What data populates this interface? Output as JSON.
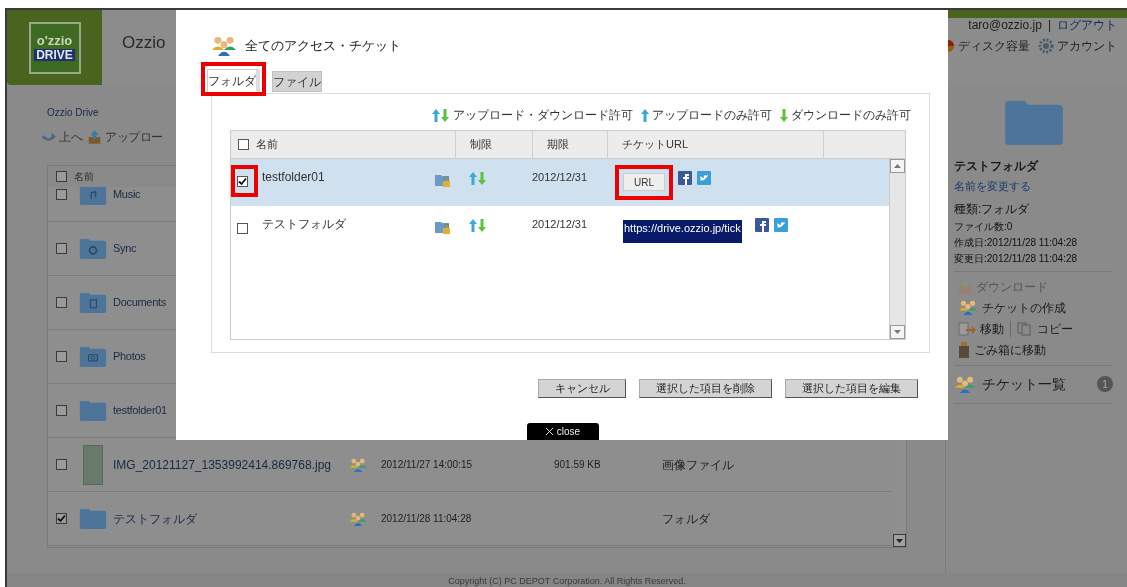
{
  "app": {
    "logo_top": "o'zzio",
    "logo_bottom": "DRIVE",
    "title": "Ozzio",
    "user": {
      "email": "taro@ozzio.jp",
      "separator": "|",
      "logout": "ログアウト"
    },
    "header_actions": [
      {
        "kind": "disk",
        "label": "ディスク容量"
      },
      {
        "kind": "account",
        "label": "アカウント"
      }
    ],
    "breadcrumb": "Ozzio Drive",
    "toolbar": [
      {
        "kind": "up",
        "label": "上へ"
      },
      {
        "kind": "upload",
        "label": "アップロー"
      }
    ],
    "file_list": {
      "header": {
        "label": "名前",
        "checked": false
      },
      "rows": [
        {
          "kind": "music",
          "name": "Music",
          "checked": false,
          "shared": false
        },
        {
          "kind": "sync",
          "name": "Sync",
          "checked": false,
          "shared": false
        },
        {
          "kind": "documents",
          "name": "Documents",
          "checked": false,
          "shared": false
        },
        {
          "kind": "photos",
          "name": "Photos",
          "checked": false,
          "shared": false
        },
        {
          "kind": "folder",
          "name": "testfolder01",
          "checked": false,
          "shared": false
        },
        {
          "kind": "image",
          "name": "IMG_20121127_1353992414.869768.jpg",
          "checked": false,
          "shared": true,
          "date": "2012/11/27 14:00:15",
          "size": "901.59 KB",
          "type": "画像ファイル"
        },
        {
          "kind": "folder",
          "name": "テストフォルダ",
          "checked": true,
          "shared": true,
          "date": "2012/11/28 11:04:28",
          "type": "フォルダ"
        }
      ]
    },
    "details": {
      "name": "テストフォルダ",
      "rename": "名前を変更する",
      "info": [
        "種類:フォルダ",
        "ファイル数:0",
        "作成日:2012/11/28 11:04:28",
        "変更日:2012/11/28 11:04:28"
      ],
      "action_rows": [
        [
          {
            "kind": "download",
            "label": "ダウンロード",
            "disabled": true
          }
        ],
        [
          {
            "kind": "ticket",
            "label": "チケットの作成",
            "disabled": false
          }
        ],
        [
          {
            "kind": "move",
            "label": "移動",
            "disabled": false
          },
          {
            "kind": "copy",
            "label": "コピー",
            "disabled": false
          }
        ],
        [
          {
            "kind": "trash",
            "label": "ごみ箱に移動",
            "disabled": false
          }
        ]
      ]
    },
    "ticket_list": {
      "label": "チケット一覧",
      "count": "1"
    },
    "footer": "Copyright (C) PC DEPOT Corporation. All Rights Reserved."
  },
  "dialog": {
    "title": "全てのアクセス・チケット",
    "tabs": [
      {
        "label": "フォルダ",
        "selected": true,
        "highlighted": true
      },
      {
        "label": "ファイル",
        "selected": false,
        "highlighted": false
      }
    ],
    "legend": [
      {
        "kind": "both",
        "label": "アップロード・ダウンロード許可"
      },
      {
        "kind": "up",
        "label": "アップロードのみ許可"
      },
      {
        "kind": "down",
        "label": "ダウンロードのみ許可"
      }
    ],
    "table": {
      "header_checked": false,
      "columns": [
        {
          "label": "名前"
        },
        {
          "label": "制限"
        },
        {
          "label": "期限"
        },
        {
          "label": "チケットURL"
        }
      ],
      "rows": [
        {
          "name": "testfolder01",
          "checked": true,
          "selected": true,
          "highlighted": true,
          "permission": {
            "kind": "both"
          },
          "expiry": "2012/12/31",
          "url": {
            "kind": "button",
            "label": "URL",
            "highlighted": true
          }
        },
        {
          "name": "テストフォルダ",
          "checked": false,
          "selected": false,
          "highlighted": false,
          "permission": {
            "kind": "both"
          },
          "expiry": "2012/12/31",
          "url": {
            "kind": "text",
            "label": "https://drive.ozzio.jp/tick",
            "highlighted": false
          }
        }
      ]
    },
    "buttons": [
      "キャンセル",
      "選択した項目を削除",
      "選択した項目を編集"
    ],
    "close": "close"
  }
}
